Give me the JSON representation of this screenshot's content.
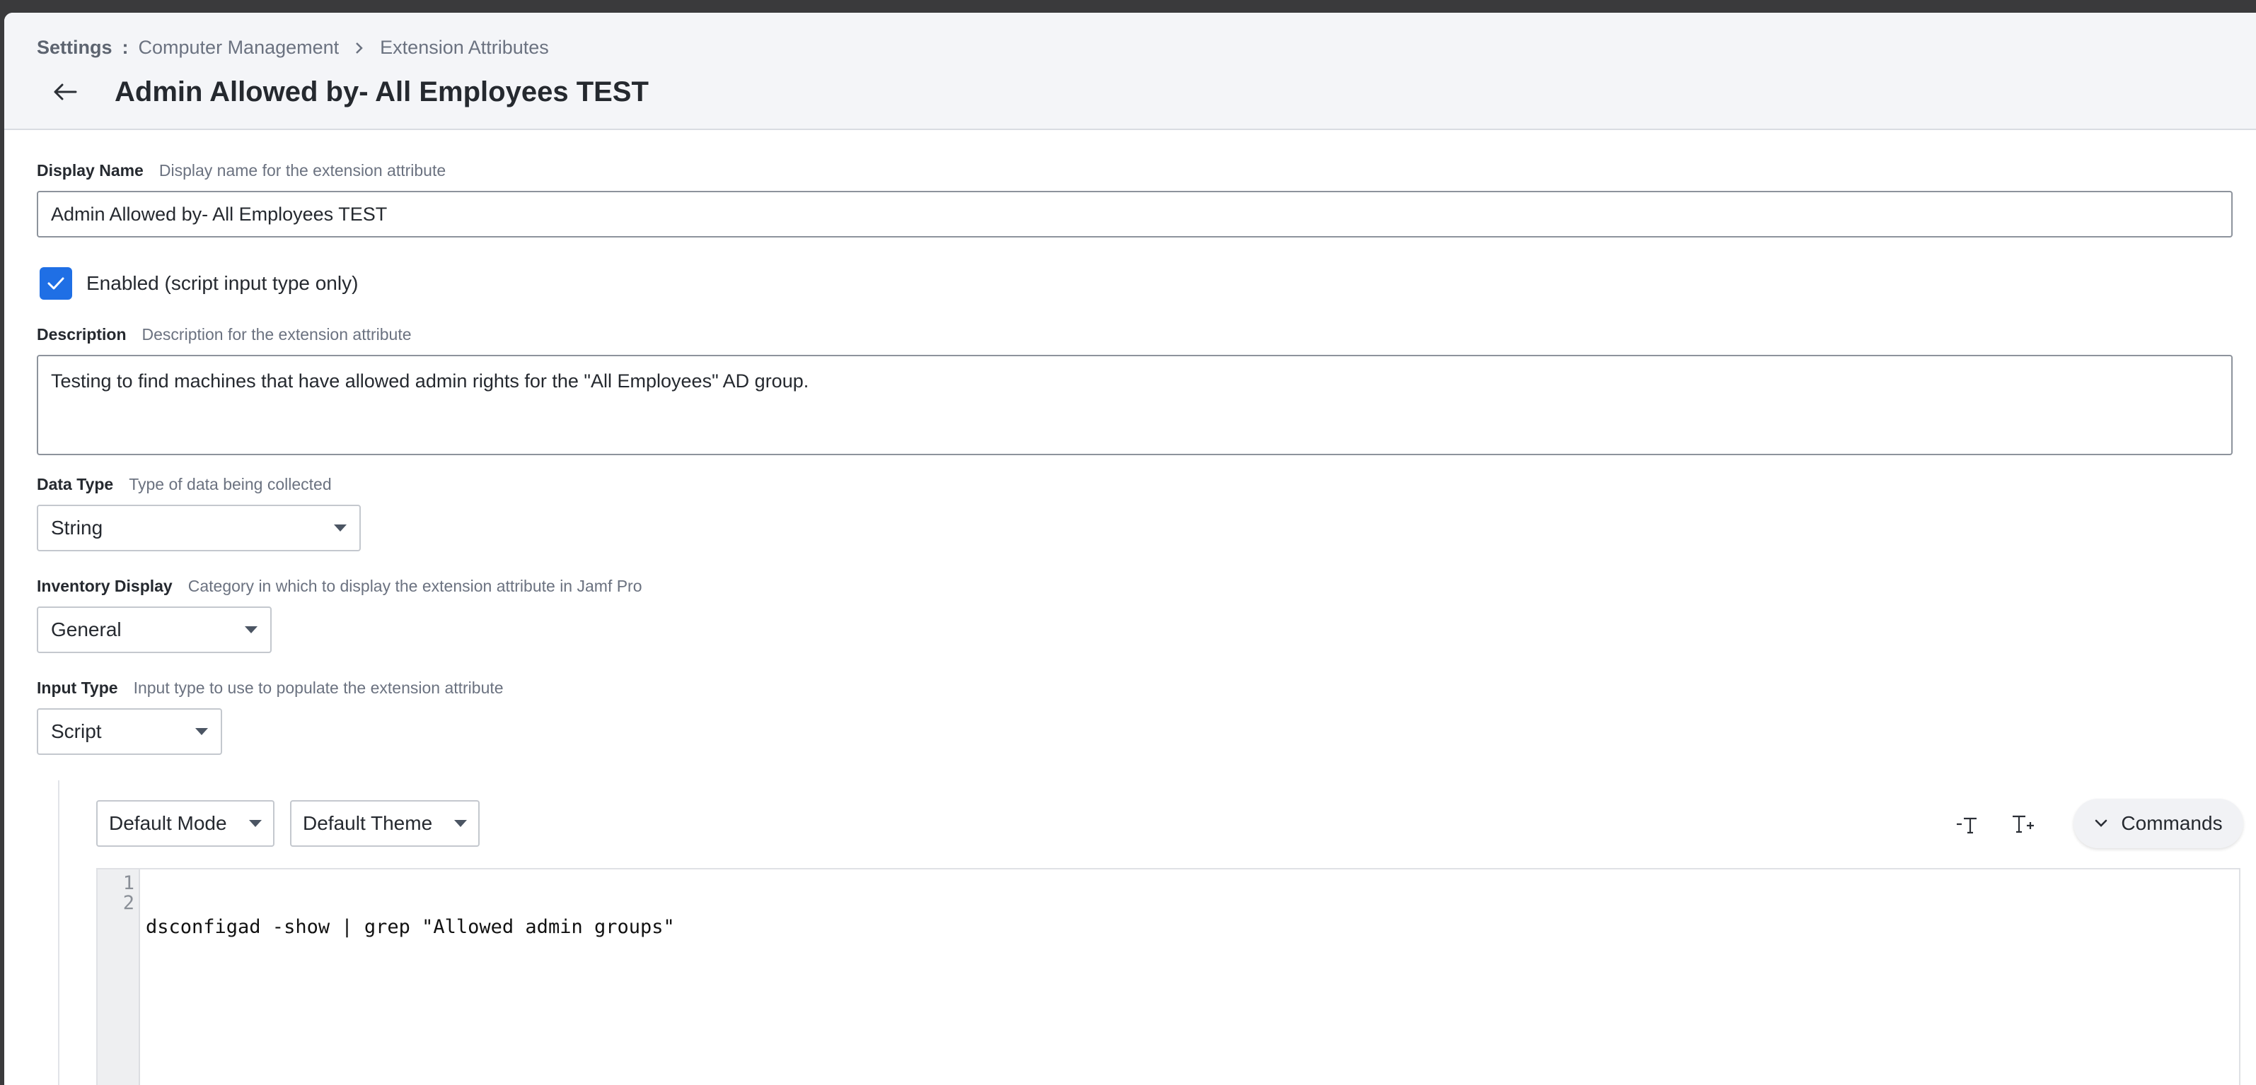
{
  "breadcrumb": {
    "root": "Settings",
    "items": [
      "Computer Management",
      "Extension Attributes"
    ]
  },
  "page_title": "Admin Allowed by- All Employees TEST",
  "display_name": {
    "label": "Display Name",
    "hint": "Display name for the extension attribute",
    "value": "Admin Allowed by- All Employees TEST"
  },
  "enabled": {
    "label": "Enabled (script input type only)",
    "checked": true
  },
  "description": {
    "label": "Description",
    "hint": "Description for the extension attribute",
    "value": "Testing to find machines that have allowed admin rights for the \"All Employees\" AD group."
  },
  "data_type": {
    "label": "Data Type",
    "hint": "Type of data being collected",
    "value": "String"
  },
  "inventory_display": {
    "label": "Inventory Display",
    "hint": "Category in which to display the extension attribute in Jamf Pro",
    "value": "General"
  },
  "input_type": {
    "label": "Input Type",
    "hint": "Input type to use to populate the extension attribute",
    "value": "Script"
  },
  "editor": {
    "mode": "Default Mode",
    "theme": "Default Theme",
    "commands_label": "Commands",
    "line_numbers": [
      "1",
      "2"
    ],
    "lines": [
      "dsconfigad -show | grep \"Allowed admin groups\"",
      ""
    ]
  },
  "colors": {
    "accent": "#1f6fe5",
    "header_bg": "#f4f5f8"
  }
}
